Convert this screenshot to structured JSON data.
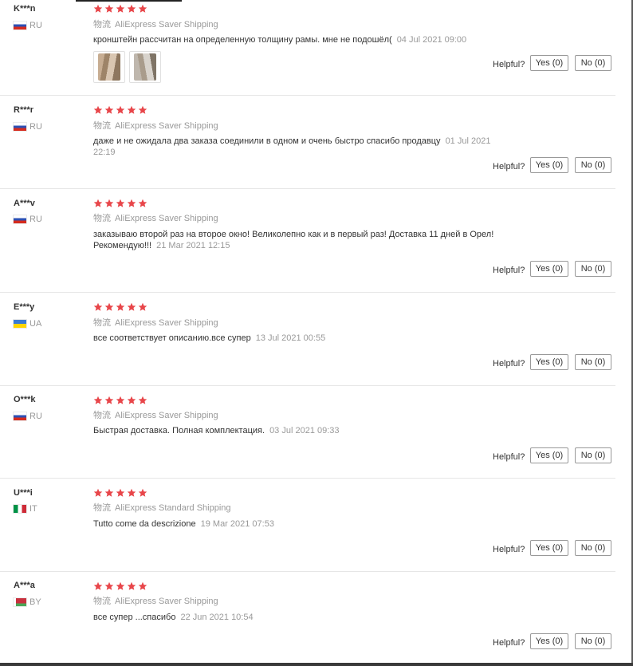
{
  "feedbacks": [
    {
      "name": "K***n",
      "country": "RU",
      "flag": "russia-flag",
      "rating": 5,
      "logistics_label": "物流",
      "shipping": "AliExpress Saver Shipping",
      "text": "кронштейн рассчитан на определенную толщину рамы. мне не подошёл(",
      "date": "04 Jul 2021 09:00",
      "photos": [
        "review-photo-1",
        "review-photo-2"
      ],
      "helpful": "Helpful?",
      "yes": "Yes (0)",
      "no": "No (0)"
    },
    {
      "name": "R***r",
      "country": "RU",
      "flag": "russia-flag",
      "rating": 5,
      "logistics_label": "物流",
      "shipping": "AliExpress Saver Shipping",
      "text": "даже и не ожидала два заказа соединили в одном и очень быстро спасибо продавцу",
      "date": "01 Jul 2021 22:19",
      "helpful": "Helpful?",
      "yes": "Yes (0)",
      "no": "No (0)"
    },
    {
      "name": "A***v",
      "country": "RU",
      "flag": "russia-flag",
      "rating": 5,
      "logistics_label": "物流",
      "shipping": "AliExpress Saver Shipping",
      "text_line1": "заказываю второй раз на второе окно! Великолепно как и в первый раз! Доставка 11 дней в Орел!",
      "text_line2": "Рекомендую!!!",
      "date": "21 Mar 2021 12:15",
      "helpful": "Helpful?",
      "yes": "Yes (0)",
      "no": "No (0)"
    },
    {
      "name": "E***y",
      "country": "UA",
      "flag": "ukraine-flag",
      "rating": 5,
      "logistics_label": "物流",
      "shipping": "AliExpress Saver Shipping",
      "text": "все соответствует описанию.все супер",
      "date": "13 Jul 2021 00:55",
      "helpful": "Helpful?",
      "yes": "Yes (0)",
      "no": "No (0)"
    },
    {
      "name": "O***k",
      "country": "RU",
      "flag": "russia-flag",
      "rating": 5,
      "logistics_label": "物流",
      "shipping": "AliExpress Saver Shipping",
      "text": "Быстрая доставка. Полная комплектация.",
      "date": "03 Jul 2021 09:33",
      "helpful": "Helpful?",
      "yes": "Yes (0)",
      "no": "No (0)"
    },
    {
      "name": "U***i",
      "country": "IT",
      "flag": "italy-flag",
      "rating": 5,
      "logistics_label": "物流",
      "shipping": "AliExpress Standard Shipping",
      "text": "Tutto come da descrizione",
      "date": "19 Mar 2021 07:53",
      "helpful": "Helpful?",
      "yes": "Yes (0)",
      "no": "No (0)"
    },
    {
      "name": "A***a",
      "country": "BY",
      "flag": "belarus-flag",
      "rating": 5,
      "logistics_label": "物流",
      "shipping": "AliExpress Saver Shipping",
      "text": "все супер ...спасибо",
      "date": "22 Jun 2021 10:54",
      "helpful": "Helpful?",
      "yes": "Yes (0)",
      "no": "No (0)"
    }
  ],
  "colors": {
    "star": "#e8464a",
    "muted": "#999999",
    "text": "#333333",
    "border": "#e6e6e6"
  }
}
